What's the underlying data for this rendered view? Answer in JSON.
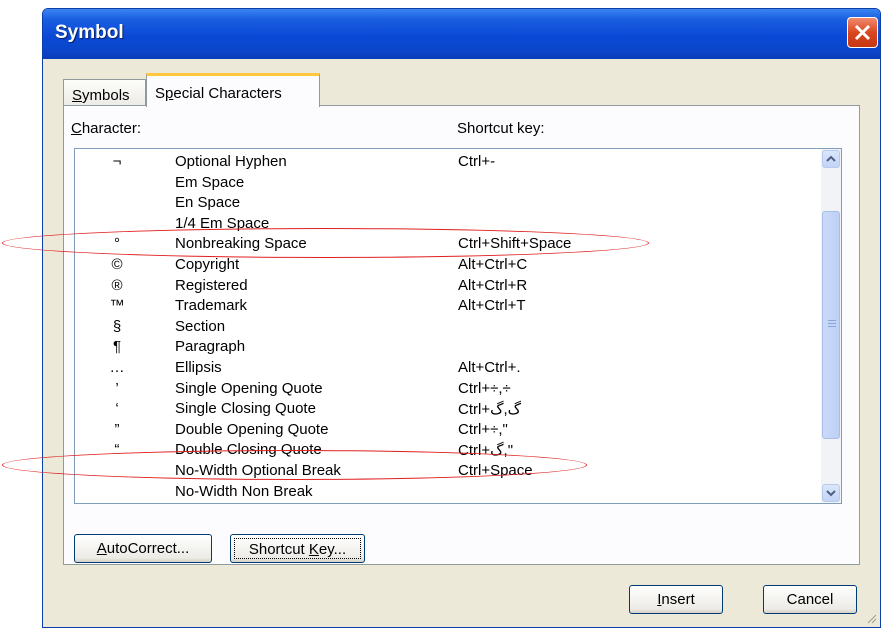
{
  "window": {
    "title": "Symbol"
  },
  "tabs": [
    {
      "label": "Symbols",
      "mnemonic": "S",
      "rest": "ymbols",
      "active": false
    },
    {
      "label": "Special Characters",
      "pre": "S",
      "mnemonic": "p",
      "rest": "ecial Characters",
      "active": true
    }
  ],
  "headers": {
    "character_mnemonic": "C",
    "character_rest": "haracter:",
    "shortcut": "Shortcut key:"
  },
  "rows": [
    {
      "symbol": "¬",
      "name": "Optional Hyphen",
      "shortcut": "Ctrl+-"
    },
    {
      "symbol": "",
      "name": "Em Space",
      "shortcut": ""
    },
    {
      "symbol": "",
      "name": "En Space",
      "shortcut": ""
    },
    {
      "symbol": "",
      "name": "1/4 Em Space",
      "shortcut": ""
    },
    {
      "symbol": "°",
      "name": "Nonbreaking Space",
      "shortcut": "Ctrl+Shift+Space"
    },
    {
      "symbol": "©",
      "name": "Copyright",
      "shortcut": "Alt+Ctrl+C"
    },
    {
      "symbol": "®",
      "name": "Registered",
      "shortcut": "Alt+Ctrl+R"
    },
    {
      "symbol": "™",
      "name": "Trademark",
      "shortcut": "Alt+Ctrl+T"
    },
    {
      "symbol": "§",
      "name": "Section",
      "shortcut": ""
    },
    {
      "symbol": "¶",
      "name": "Paragraph",
      "shortcut": ""
    },
    {
      "symbol": "…",
      "name": "Ellipsis",
      "shortcut": "Alt+Ctrl+."
    },
    {
      "symbol": "’",
      "name": "Single Opening Quote",
      "shortcut": "Ctrl+÷,÷"
    },
    {
      "symbol": "‘",
      "name": "Single Closing Quote",
      "shortcut": "Ctrl+گ,گ"
    },
    {
      "symbol": "”",
      "name": "Double Opening Quote",
      "shortcut": "Ctrl+÷,\""
    },
    {
      "symbol": "“",
      "name": "Double Closing Quote",
      "shortcut": "Ctrl+گ,\""
    },
    {
      "symbol": "",
      "name": "No-Width Optional Break",
      "shortcut": "Ctrl+Space"
    },
    {
      "symbol": "",
      "name": "No-Width Non Break",
      "shortcut": ""
    }
  ],
  "buttons": {
    "autocorrect": {
      "mnemonic": "A",
      "rest": "utoCorrect..."
    },
    "shortcut_key": {
      "pre": "Shortcut ",
      "mnemonic": "K",
      "rest": "ey..."
    },
    "insert": {
      "mnemonic": "I",
      "rest": "nsert"
    },
    "cancel": {
      "label": "Cancel"
    }
  },
  "annotations": {
    "color": "#e02020",
    "highlighted_rows": [
      "Nonbreaking Space",
      "No-Width Optional Break"
    ]
  },
  "colors": {
    "titlebar": "#0a49d6",
    "active_tab_accent": "#ffc83c",
    "dialog_face": "#ece9d8"
  }
}
